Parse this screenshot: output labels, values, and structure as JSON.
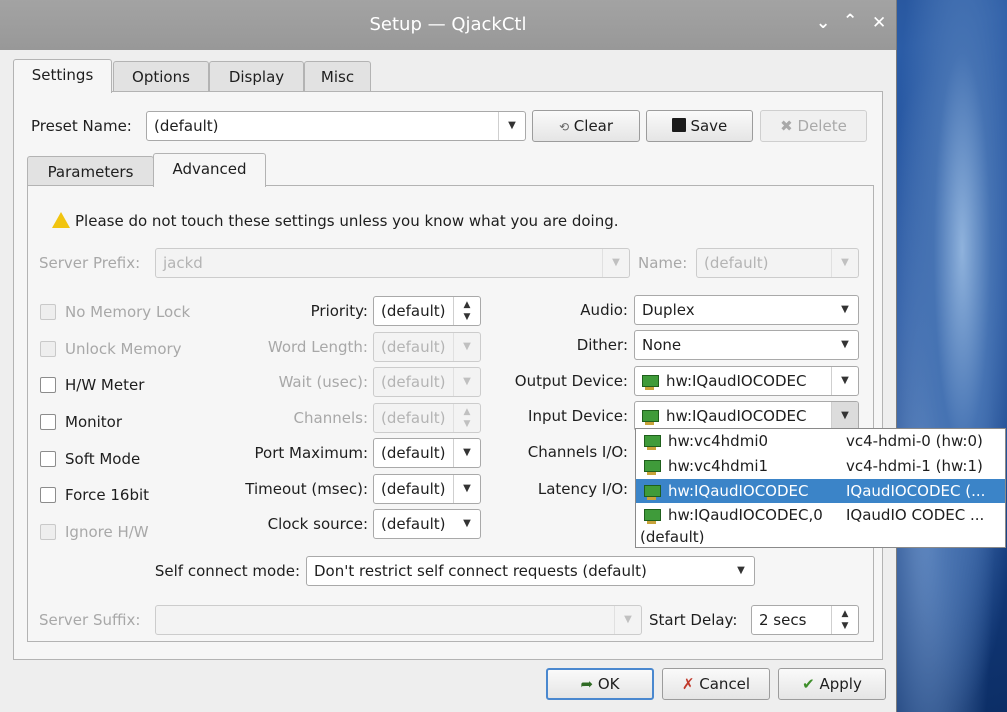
{
  "window": {
    "title": "Setup — QjackCtl",
    "controls": [
      "⌵",
      "⌃",
      "✕"
    ]
  },
  "tabs": [
    "Settings",
    "Options",
    "Display",
    "Misc"
  ],
  "preset": {
    "label": "Preset Name:",
    "value": "(default)"
  },
  "buttons": {
    "clear": "Clear",
    "save": "Save",
    "delete": "Delete",
    "ok": "OK",
    "cancel": "Cancel",
    "apply": "Apply"
  },
  "subtabs": [
    "Parameters",
    "Advanced"
  ],
  "warning": "Please do not touch these settings unless you know what you are doing.",
  "server_prefix": {
    "label": "Server Prefix:",
    "value": "jackd"
  },
  "name": {
    "label": "Name:",
    "value": "(default)"
  },
  "checkboxes": [
    "No Memory Lock",
    "Unlock Memory",
    "H/W Meter",
    "Monitor",
    "Soft Mode",
    "Force 16bit",
    "Ignore H/W"
  ],
  "params": {
    "priority": {
      "label": "Priority:",
      "value": "(default)"
    },
    "word_length": {
      "label": "Word Length:",
      "value": "(default)"
    },
    "wait": {
      "label": "Wait (usec):",
      "value": "(default)"
    },
    "channels": {
      "label": "Channels:",
      "value": "(default)"
    },
    "port_maximum": {
      "label": "Port Maximum:",
      "value": "(default)"
    },
    "timeout": {
      "label": "Timeout (msec):",
      "value": "(default)"
    },
    "clock_source": {
      "label": "Clock source:",
      "value": "(default)"
    }
  },
  "audio": {
    "label": "Audio:",
    "value": "Duplex"
  },
  "dither": {
    "label": "Dither:",
    "value": "None"
  },
  "output_device": {
    "label": "Output Device:",
    "value": "hw:IQaudIOCODEC"
  },
  "input_device": {
    "label": "Input Device:",
    "value": "hw:IQaudIOCODEC"
  },
  "channels_io": {
    "label": "Channels I/O:"
  },
  "latency_io": {
    "label": "Latency I/O:"
  },
  "device_list": [
    {
      "device": "hw:vc4hdmi0",
      "desc": "vc4-hdmi-0 (hw:0)"
    },
    {
      "device": "hw:vc4hdmi1",
      "desc": "vc4-hdmi-1 (hw:1)"
    },
    {
      "device": "hw:IQaudIOCODEC",
      "desc": "IQaudIOCODEC (...",
      "selected": true
    },
    {
      "device": "hw:IQaudIOCODEC,0",
      "desc": "IQaudIO CODEC ..."
    },
    {
      "device": "(default)",
      "desc": ""
    }
  ],
  "self_connect": {
    "label": "Self connect mode:",
    "value": "Don't restrict self connect requests (default)"
  },
  "server_suffix": {
    "label": "Server Suffix:",
    "value": ""
  },
  "start_delay": {
    "label": "Start Delay:",
    "value": "2 secs"
  }
}
